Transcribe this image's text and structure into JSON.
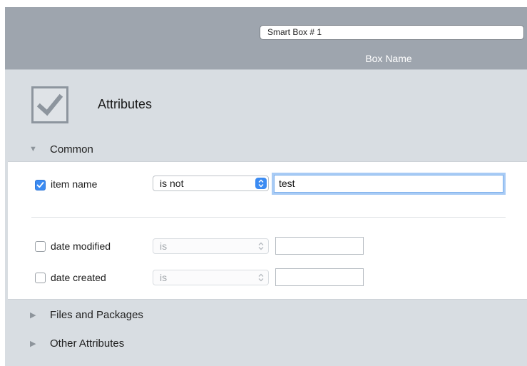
{
  "header": {
    "box_name_value": "Smart Box # 1",
    "box_name_label": "Box Name"
  },
  "attributes": {
    "title": "Attributes",
    "icon": "checkbox-icon"
  },
  "sections": {
    "common": {
      "label": "Common",
      "expanded": true
    },
    "files_and_packages": {
      "label": "Files and Packages",
      "expanded": false
    },
    "other_attributes": {
      "label": "Other Attributes",
      "expanded": false
    }
  },
  "rules": [
    {
      "checked": true,
      "label": "item name",
      "operator": "is not",
      "value": "test",
      "enabled": true
    },
    {
      "checked": false,
      "label": "date modified",
      "operator": "is",
      "value": "",
      "enabled": false
    },
    {
      "checked": false,
      "label": "date created",
      "operator": "is",
      "value": "",
      "enabled": false
    }
  ],
  "colors": {
    "header_bg": "#9ea5ae",
    "panel_bg": "#d8dde2",
    "accent": "#3b8bf2"
  }
}
